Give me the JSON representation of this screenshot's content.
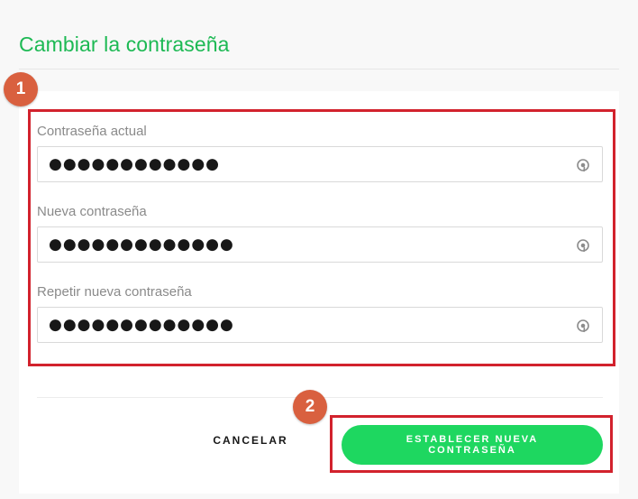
{
  "page": {
    "title": "Cambiar la contraseña",
    "accent_color": "#1db954"
  },
  "form": {
    "fields": [
      {
        "label": "Contraseña actual",
        "value": "●●●●●●●●●●●●",
        "icon": "eye-icon"
      },
      {
        "label": "Nueva contraseña",
        "value": "●●●●●●●●●●●●●",
        "icon": "eye-icon"
      },
      {
        "label": "Repetir nueva contraseña",
        "value": "●●●●●●●●●●●●●",
        "icon": "eye-icon"
      }
    ]
  },
  "actions": {
    "cancel_label": "CANCELAR",
    "submit_label_line1": "ESTABLECER NUEVA",
    "submit_label_line2": "CONTRASEÑA",
    "submit_color": "#1ed760"
  },
  "annotations": {
    "badge_1": "1",
    "badge_2": "2",
    "box_color": "#d2222d",
    "badge_color": "#d9603f"
  }
}
